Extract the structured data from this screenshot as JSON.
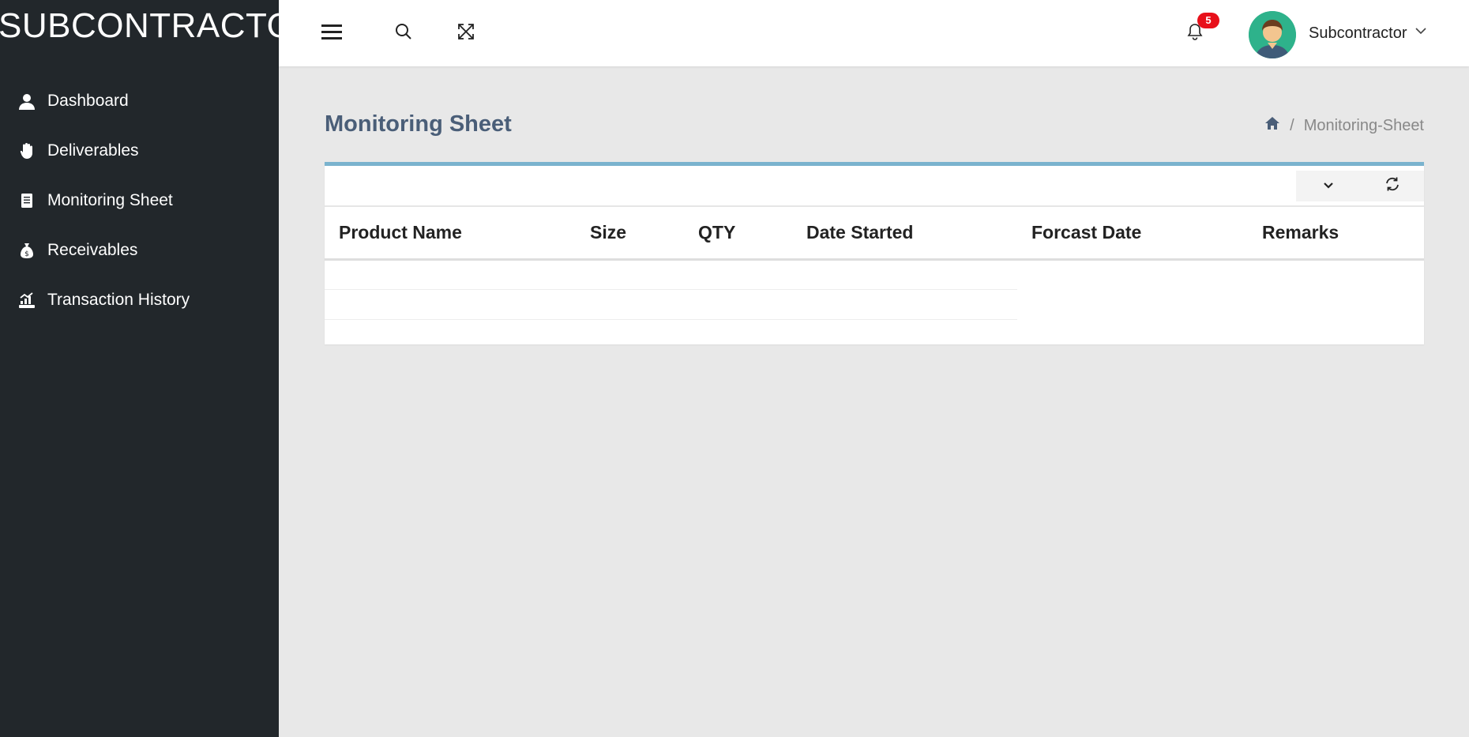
{
  "sidebar": {
    "brand": "SUBCONTRACTOR",
    "items": [
      {
        "label": "Dashboard",
        "icon": "user-icon"
      },
      {
        "label": "Deliverables",
        "icon": "hand-icon"
      },
      {
        "label": "Monitoring Sheet",
        "icon": "document-icon"
      },
      {
        "label": "Receivables",
        "icon": "money-bag-icon"
      },
      {
        "label": "Transaction History",
        "icon": "hand-holding-chart-icon"
      }
    ]
  },
  "topbar": {
    "notification_count": "5",
    "user_name": "Subcontractor"
  },
  "page": {
    "title": "Monitoring Sheet",
    "breadcrumb_current": "Monitoring-Sheet"
  },
  "table": {
    "columns": [
      "Product Name",
      "Size",
      "QTY",
      "Date Started",
      "Forcast Date",
      "Remarks"
    ],
    "rows": []
  },
  "colors": {
    "sidebar_bg": "#22272b",
    "card_accent": "#7ab3ce",
    "title_color": "#4a5e78",
    "badge_red": "#e8101a"
  }
}
